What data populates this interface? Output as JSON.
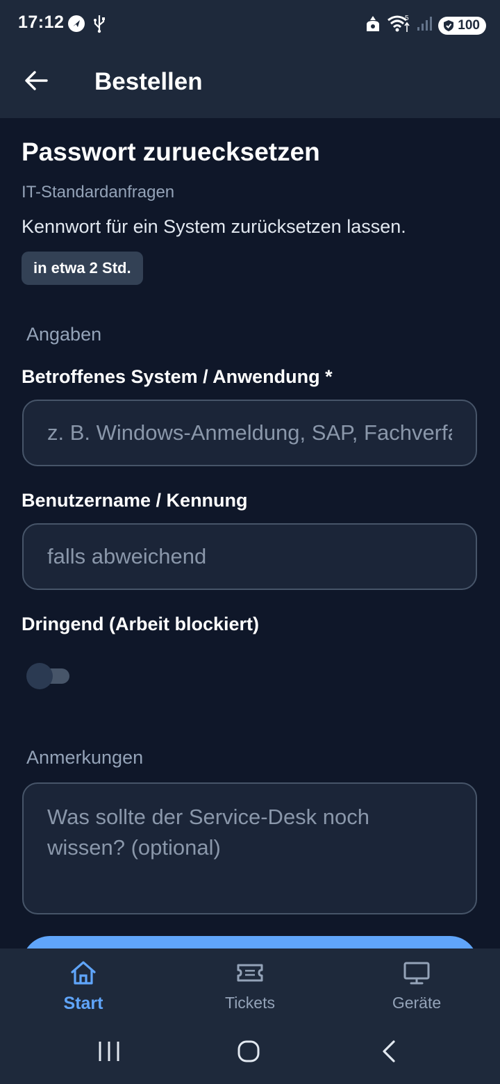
{
  "status_bar": {
    "time": "17:12",
    "battery": "100",
    "icons": [
      "navigation-icon",
      "usb-icon",
      "person-alert-icon",
      "wifi-icon",
      "cell-signal-icon",
      "battery-icon"
    ]
  },
  "app_bar": {
    "title": "Bestellen",
    "back_icon": "arrow-left-icon"
  },
  "service": {
    "title": "Passwort zuruecksetzen",
    "category": "IT-Standardanfragen",
    "description": "Kennwort für ein System zurücksetzen lassen.",
    "eta": "in etwa 2 Std."
  },
  "form": {
    "section_details": "Angaben",
    "system_label": "Betroffenes System / Anwendung *",
    "system_placeholder": "z. B. Windows-Anmeldung, SAP, Fachverfahren",
    "system_value": "",
    "username_label": "Benutzername / Kennung",
    "username_placeholder": "falls abweichend",
    "username_value": "",
    "urgent_label": "Dringend (Arbeit blockiert)",
    "urgent_on": false,
    "section_notes": "Anmerkungen",
    "notes_placeholder": "Was sollte der Service-Desk noch wissen? (optional)",
    "notes_value": ""
  },
  "bottom_nav": {
    "items": [
      {
        "label": "Start",
        "icon": "home-icon",
        "active": true
      },
      {
        "label": "Tickets",
        "icon": "ticket-icon",
        "active": false
      },
      {
        "label": "Geräte",
        "icon": "monitor-icon",
        "active": false
      }
    ]
  },
  "colors": {
    "background": "#0f1729",
    "surface": "#1e293b",
    "accent": "#60a5fa",
    "muted_text": "#94a3b8"
  }
}
